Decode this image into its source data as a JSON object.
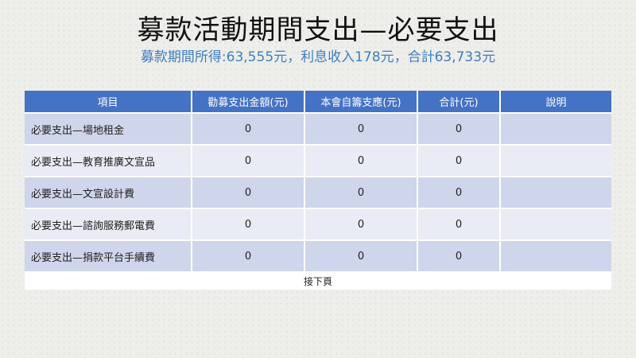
{
  "slide": {
    "title": "募款活動期間支出—必要支出",
    "subtitle": "募款期間所得:63,555元，利息收入178元，合計63,733元"
  },
  "table": {
    "headers": [
      "項目",
      "勸募支出金額(元)",
      "本會自籌支應(元)",
      "合計(元)",
      "說明"
    ],
    "rows": [
      {
        "item": "必要支出—場地租金",
        "fundraising": "0",
        "self_funded": "0",
        "total": "0",
        "note": ""
      },
      {
        "item": "必要支出—教育推廣文宣品",
        "fundraising": "0",
        "self_funded": "0",
        "total": "0",
        "note": ""
      },
      {
        "item": "必要支出—文宣設計費",
        "fundraising": "0",
        "self_funded": "0",
        "total": "0",
        "note": ""
      },
      {
        "item": "必要支出—諮詢服務郵電費",
        "fundraising": "0",
        "self_funded": "0",
        "total": "0",
        "note": ""
      },
      {
        "item": "必要支出—捐款平台手續費",
        "fundraising": "0",
        "self_funded": "0",
        "total": "0",
        "note": ""
      }
    ],
    "footer": "接下頁"
  },
  "colors": {
    "header_bg": "#4472c4",
    "row_odd_bg": "#cfd5ea",
    "row_even_bg": "#e9ebf5",
    "subtitle": "#3f7fc0"
  }
}
